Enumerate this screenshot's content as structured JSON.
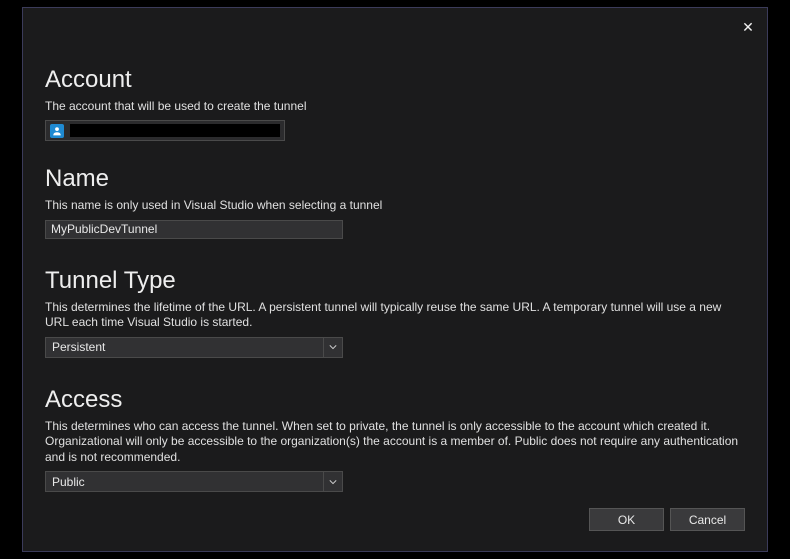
{
  "sections": {
    "account": {
      "title": "Account",
      "desc": "The account that will be used to create the tunnel",
      "value_redacted": true
    },
    "name": {
      "title": "Name",
      "desc": "This name is only used in Visual Studio when selecting a tunnel",
      "value": "MyPublicDevTunnel"
    },
    "tunnel_type": {
      "title": "Tunnel Type",
      "desc": "This determines the lifetime of the URL. A persistent tunnel will typically reuse the same URL. A temporary tunnel will use a new URL each time Visual Studio is started.",
      "value": "Persistent"
    },
    "access": {
      "title": "Access",
      "desc": "This determines who can access the tunnel. When set to private, the tunnel is only accessible to the account which created it. Organizational will only be accessible to the organization(s) the account is a member of. Public does not require any authentication and is not recommended.",
      "value": "Public"
    }
  },
  "buttons": {
    "ok": "OK",
    "cancel": "Cancel"
  }
}
